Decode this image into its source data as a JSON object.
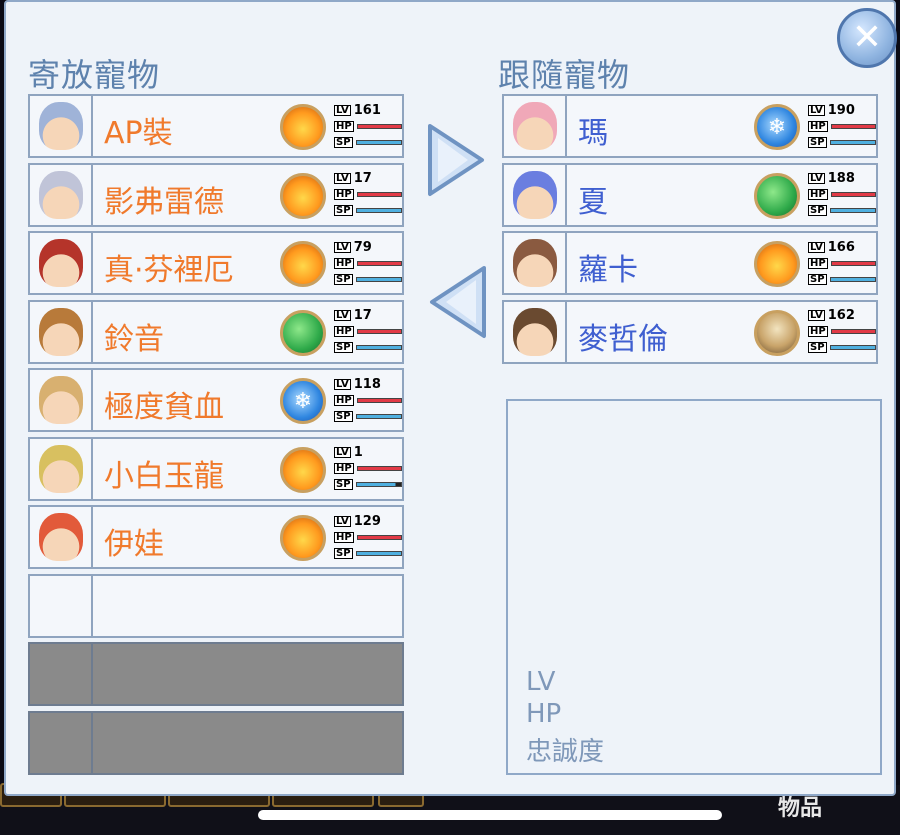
{
  "background": {
    "label": "物品"
  },
  "left_panel": {
    "title": "寄放寵物",
    "pets": [
      {
        "name": "AP裝",
        "element": "fire",
        "lv": "161",
        "hp": 1.0,
        "sp": 1.0,
        "portrait": "silver-hair-girl",
        "color": "#9fb3d8"
      },
      {
        "name": "影弗雷德",
        "element": "fire",
        "lv": "17",
        "hp": 1.0,
        "sp": 1.0,
        "portrait": "silver-hair-elf",
        "color": "#c0c4d8"
      },
      {
        "name": "真·芬裡厄",
        "element": "fire",
        "lv": "79",
        "hp": 1.0,
        "sp": 1.0,
        "portrait": "red-wolf",
        "color": "#b5342a"
      },
      {
        "name": "鈴音",
        "element": "wind",
        "lv": "17",
        "hp": 1.0,
        "sp": 1.0,
        "portrait": "brown-hair-girl",
        "color": "#b87a3a"
      },
      {
        "name": "極度貧血",
        "element": "water",
        "lv": "118",
        "hp": 1.0,
        "sp": 1.0,
        "portrait": "blonde-girl",
        "color": "#d8b070"
      },
      {
        "name": "小白玉龍",
        "element": "fire",
        "lv": "1",
        "hp": 1.0,
        "sp": 0.88,
        "portrait": "golden-dragon",
        "color": "#d8c060"
      },
      {
        "name": "伊娃",
        "element": "fire",
        "lv": "129",
        "hp": 1.0,
        "sp": 1.0,
        "portrait": "red-hair-girl",
        "color": "#e25a3a"
      }
    ]
  },
  "right_panel": {
    "title": "跟隨寵物",
    "pets": [
      {
        "name": "瑪",
        "element": "water",
        "lv": "190",
        "hp": 1.0,
        "sp": 1.0,
        "portrait": "pink-hair-girl",
        "color": "#f0a8b8"
      },
      {
        "name": "夏",
        "element": "wind",
        "lv": "188",
        "hp": 1.0,
        "sp": 1.0,
        "portrait": "blue-hair-boy",
        "color": "#6a7ee0"
      },
      {
        "name": "蘿卡",
        "element": "fire",
        "lv": "166",
        "hp": 1.0,
        "sp": 1.0,
        "portrait": "headband-boy",
        "color": "#8a5a40"
      },
      {
        "name": "麥哲倫",
        "element": "earth",
        "lv": "162",
        "hp": 1.0,
        "sp": 1.0,
        "portrait": "hat-man",
        "color": "#6a4a30"
      }
    ]
  },
  "detail": {
    "lv_label": "LV",
    "hp_label": "HP",
    "loyalty_label": "忠誠度"
  },
  "stat_tags": {
    "lv": "LV",
    "hp": "HP",
    "sp": "SP"
  },
  "buttons": {
    "close": "✕",
    "move_right": "move-to-follow",
    "move_left": "move-to-storage"
  },
  "colors": {
    "left_name": "#f07a2c",
    "right_name": "#3f5fd0",
    "title": "#5e82ad"
  }
}
